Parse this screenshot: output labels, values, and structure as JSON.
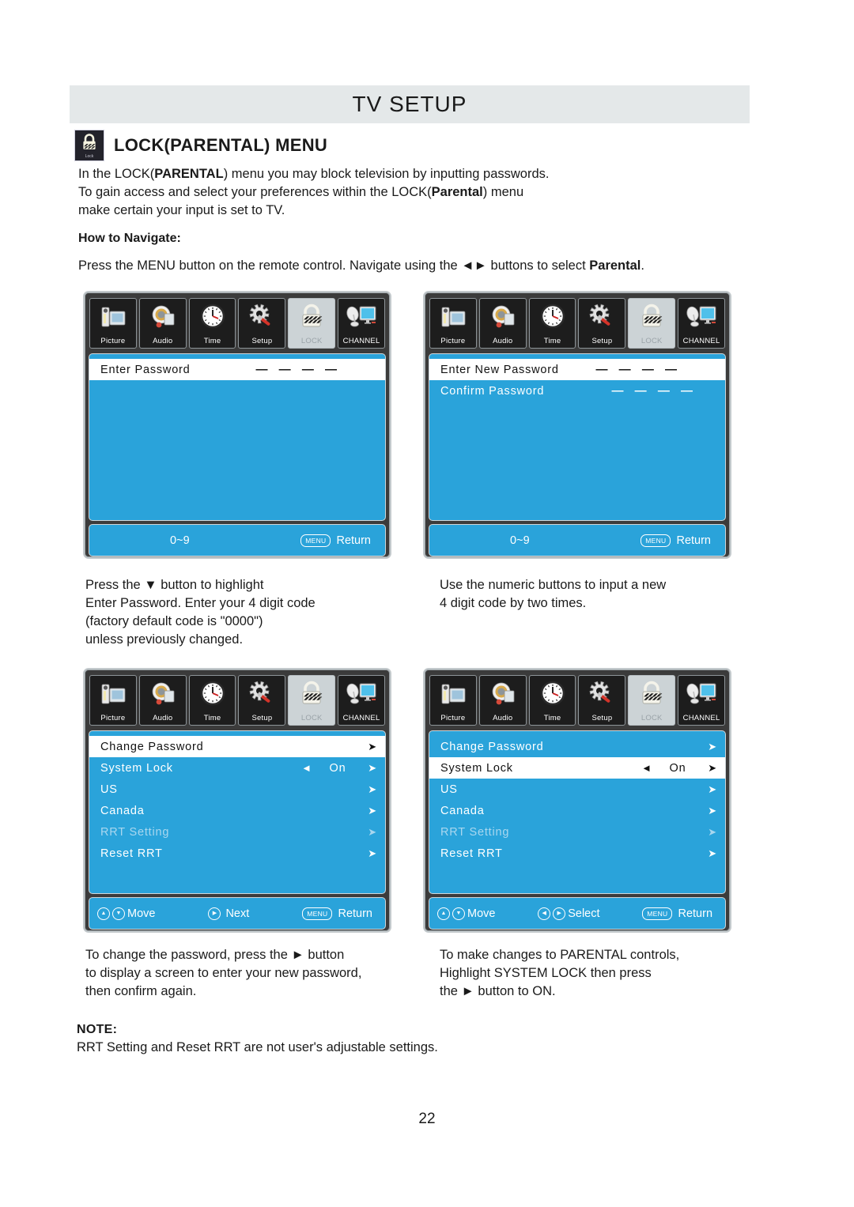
{
  "banner": {
    "title": "TV SETUP"
  },
  "section": {
    "icon": "lock-icon",
    "icon_caption": "Lock",
    "title": "LOCK(PARENTAL) MENU"
  },
  "intro": {
    "line1_a": "In the LOCK(",
    "line1_b": "PARENTAL",
    "line1_c": ") menu you may block television by inputting passwords.",
    "line2_a": "To gain access and select your preferences within the LOCK(",
    "line2_b": "Parental",
    "line2_c": ") menu",
    "line3": "make certain your input is set to TV."
  },
  "howto": {
    "label": "How to Navigate:",
    "text_a": "Press the MENU button on the remote control. Navigate using the ",
    "arrows": "◄►",
    "text_b": " buttons to select ",
    "bold": "Parental",
    "text_c": "."
  },
  "icon_bar": [
    {
      "name": "picture-icon",
      "label": "Picture",
      "selected": false
    },
    {
      "name": "audio-icon",
      "label": "Audio",
      "selected": false
    },
    {
      "name": "time-icon",
      "label": "Time",
      "selected": false
    },
    {
      "name": "setup-icon",
      "label": "Setup",
      "selected": false
    },
    {
      "name": "lock-icon",
      "label": "LOCK",
      "selected": true
    },
    {
      "name": "channel-icon",
      "label": "CHANNEL",
      "selected": false
    }
  ],
  "osd1": {
    "rows": [
      {
        "label": "Enter Password",
        "dashes": "— — — —",
        "highlighted": true
      }
    ],
    "footer": {
      "numeric": "0~9",
      "menu_key": "MENU",
      "return": "Return"
    }
  },
  "osd2": {
    "rows": [
      {
        "label": "Enter New Password",
        "dashes": "— — — —",
        "highlighted": true
      },
      {
        "label": "Confirm Password",
        "dashes": "— — — —",
        "highlighted": false
      }
    ],
    "footer": {
      "numeric": "0~9",
      "menu_key": "MENU",
      "return": "Return"
    }
  },
  "osd3": {
    "rows": [
      {
        "label": "Change Password",
        "highlighted": true,
        "arrow": "➤"
      },
      {
        "label": "System Lock",
        "highlighted": false,
        "left_arrow": "◄",
        "value": "On",
        "arrow": "➤"
      },
      {
        "label": "US",
        "highlighted": false,
        "arrow": "➤"
      },
      {
        "label": "Canada",
        "highlighted": false,
        "arrow": "➤"
      },
      {
        "label": "RRT Setting",
        "highlighted": false,
        "dim": true,
        "arrow": "➤"
      },
      {
        "label": "Reset RRT",
        "highlighted": false,
        "arrow": "➤"
      }
    ],
    "footer": {
      "move": "Move",
      "middle": "Next",
      "menu_key": "MENU",
      "return": "Return"
    }
  },
  "osd4": {
    "rows": [
      {
        "label": "Change Password",
        "highlighted": false,
        "arrow": "➤"
      },
      {
        "label": "System Lock",
        "highlighted": true,
        "left_arrow": "◄",
        "value": "On",
        "arrow": "➤"
      },
      {
        "label": "US",
        "highlighted": false,
        "arrow": "➤"
      },
      {
        "label": "Canada",
        "highlighted": false,
        "arrow": "➤"
      },
      {
        "label": "RRT Setting",
        "highlighted": false,
        "dim": true,
        "arrow": "➤"
      },
      {
        "label": "Reset RRT",
        "highlighted": false,
        "arrow": "➤"
      }
    ],
    "footer": {
      "move": "Move",
      "middle": "Select",
      "menu_key": "MENU",
      "return": "Return"
    }
  },
  "captions": {
    "left_top": "Press the ▼ button to highlight\nEnter Password. Enter your 4 digit code\n(factory default code is \"0000\")\nunless previously changed.",
    "right_top": "Use the numeric buttons to input a new\n4 digit code by two times.",
    "left_bottom": "To change the password, press the ► button\nto display a screen to enter your new password,\nthen confirm again.",
    "right_bottom": "To make changes to PARENTAL controls,\nHighlight SYSTEM LOCK then press\nthe ► button to ON."
  },
  "note": {
    "label": "NOTE:",
    "text": "RRT Setting and Reset RRT are not user's adjustable settings."
  },
  "page_number": "22",
  "colors": {
    "banner_bg": "#e4e8e9",
    "osd_blue": "#2aa3da",
    "osd_frame": "#3b3b3b",
    "icon_bg": "#1d1d1d",
    "icon_selected_bg": "#ccd3d6",
    "text": "#1a1a1a"
  }
}
